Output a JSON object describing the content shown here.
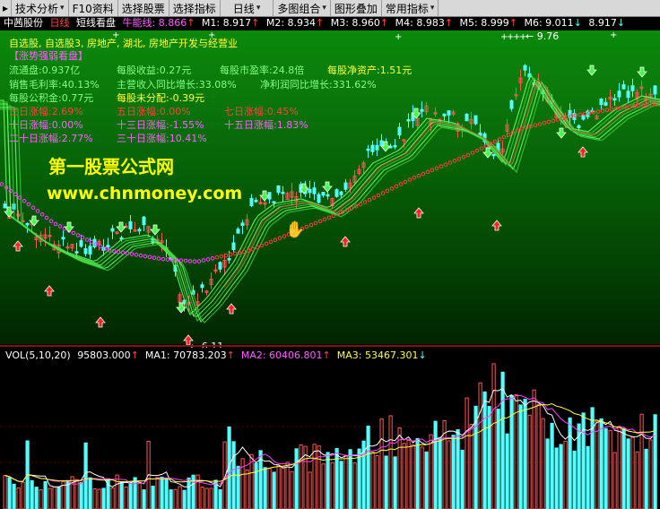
{
  "toolbar": {
    "items": [
      "技术分析",
      "F10资料",
      "选择股票",
      "选择指标",
      "日线",
      "多图组合",
      "图形叠加",
      "常用指标"
    ]
  },
  "infobar": {
    "stock_name": "中茜股份",
    "period": "日线",
    "indicator_name": "短线看盘",
    "energy_label": "牛能线: 8.866",
    "m1": "M1: 8.917",
    "m2": "M2: 8.934",
    "m3": "M3: 8.960",
    "m4": "M4: 8.983",
    "m5": "M5: 8.999",
    "m6": "M6: 9.011",
    "m7": "8.917"
  },
  "overlay": {
    "industry_line": "自选股, 自选股3, 房地产, 湖北, 房地产开发与经营业",
    "circulating": "流通盘:0.937亿",
    "eps": "每股收益:0.27元",
    "pe": "每股市盈率:24.8倍",
    "bvps": "每股净资产:1.51元",
    "gross_margin": "销售毛利率:40.13%",
    "revenue_growth": "主营收入同比增长:33.08%",
    "profit_growth": "净利润同比增长:331.62%",
    "reserve": "每股公积金:0.77元",
    "undistributed": "每股未分配:-0.39元",
    "chg3": "三日涨幅:2.69%",
    "chg5": "五日涨幅:0.00%",
    "chg7": "七日涨幅:0.45%",
    "chg10": "十日涨幅:0.00%",
    "chg13": "十三日涨幅:-1.55%",
    "chg15": "十五日涨幅:1.83%",
    "chg20": "二十日涨幅:2.77%",
    "chg30": "三十日涨幅:10.41%",
    "band_label": "【涨势强弱看盘】",
    "high_label": "9.76",
    "low_label": "6.11"
  },
  "watermark": {
    "line1": "第一股票公式网",
    "line2": "www.chnmoney.com"
  },
  "volume": {
    "label": "VOL(5,10,20)",
    "value": "95803.000",
    "ma1": "MA1: 70783.203",
    "ma2": "MA2: 60406.801",
    "ma3": "MA3: 53467.301"
  },
  "colors": {
    "up": "#ff5555",
    "down": "#54ffff",
    "ma_green": "#66ff66",
    "signal_circle": "#ff4040",
    "text_yellow": "#ffff40",
    "text_green": "#80ff80",
    "text_red": "#ff4040",
    "text_magenta": "#ff60ff"
  }
}
